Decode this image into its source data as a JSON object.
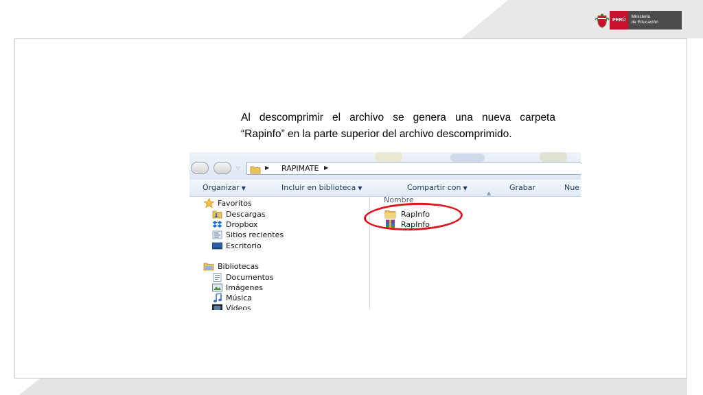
{
  "logo": {
    "country": "PERÚ",
    "ministry_line1": "Ministerio",
    "ministry_line2": "de Educación",
    "accent_red": "#c8102e",
    "accent_dark": "#4b4b4b"
  },
  "caption": {
    "line1": "Al descomprimir el archivo se genera una nueva carpeta",
    "line2": "“Rapinfo” en la parte superior del archivo descomprimido."
  },
  "explorer": {
    "address": {
      "path": "RAPIMATE",
      "folder_icon": "folder-icon"
    },
    "toolbar": {
      "items": [
        {
          "label": "Organizar",
          "dropdown": true
        },
        {
          "label": "Incluir en biblioteca",
          "dropdown": true
        },
        {
          "label": "Compartir con",
          "dropdown": true
        },
        {
          "label": "Grabar",
          "dropdown": false
        },
        {
          "label": "Nue",
          "dropdown": false
        }
      ]
    },
    "nav_pane": {
      "favorites": {
        "label": "Favoritos",
        "icon": "star-icon",
        "items": [
          {
            "label": "Descargas",
            "icon": "downloads-folder-icon"
          },
          {
            "label": "Dropbox",
            "icon": "dropbox-icon"
          },
          {
            "label": "Sitios recientes",
            "icon": "recent-places-icon"
          },
          {
            "label": "Escritorio",
            "icon": "desktop-icon"
          }
        ]
      },
      "libraries": {
        "label": "Bibliotecas",
        "icon": "libraries-icon",
        "items": [
          {
            "label": "Documentos",
            "icon": "documents-icon"
          },
          {
            "label": "Imágenes",
            "icon": "pictures-icon"
          },
          {
            "label": "Música",
            "icon": "music-icon"
          },
          {
            "label": "Vídeos",
            "icon": "videos-icon"
          }
        ]
      }
    },
    "content": {
      "column_header": "Nombre",
      "files": [
        {
          "name": "RapInfo",
          "type": "folder",
          "icon": "folder-icon"
        },
        {
          "name": "RapInfo",
          "type": "archive",
          "icon": "winrar-archive-icon"
        }
      ],
      "highlight_color": "#e0141e"
    }
  }
}
